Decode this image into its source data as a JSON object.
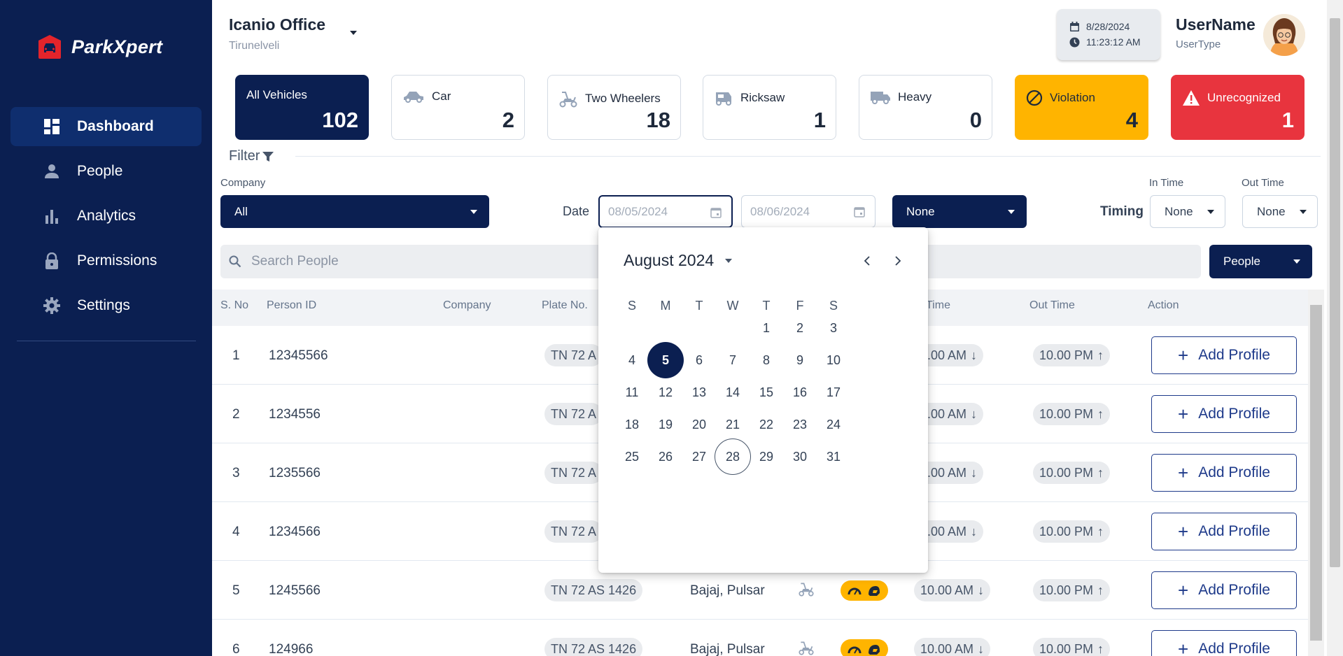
{
  "brand": {
    "name": "ParkXpert"
  },
  "nav": [
    {
      "label": "Dashboard",
      "icon": "dashboard-icon",
      "active": true
    },
    {
      "label": "People",
      "icon": "person-icon"
    },
    {
      "label": "Analytics",
      "icon": "bar-chart-icon"
    },
    {
      "label": "Permissions",
      "icon": "lock-icon"
    },
    {
      "label": "Settings",
      "icon": "gear-icon"
    }
  ],
  "header": {
    "office_name": "Icanio Office",
    "office_location": "Tirunelveli",
    "date": "8/28/2024",
    "time": "11:23:12 AM",
    "user_name": "UserName",
    "user_type": "UserType"
  },
  "stats": [
    {
      "label": "All Vehicles",
      "value": "102",
      "style": "dark"
    },
    {
      "label": "Car",
      "value": "2",
      "icon": "car-icon"
    },
    {
      "label": "Two Wheelers",
      "value": "18",
      "icon": "scooter-icon"
    },
    {
      "label": "Ricksaw",
      "value": "1",
      "icon": "rickshaw-icon"
    },
    {
      "label": "Heavy",
      "value": "0",
      "icon": "truck-icon"
    },
    {
      "label": "Violation",
      "value": "4",
      "icon": "ban-icon",
      "style": "yellow"
    },
    {
      "label": "Unrecognized",
      "value": "1",
      "icon": "warning-icon",
      "style": "red"
    }
  ],
  "filter": {
    "title": "Filter",
    "company_label": "Company",
    "company_value": "All",
    "date_label": "Date",
    "date_from": "08/05/2024",
    "date_to": "08/06/2024",
    "type_value": "None",
    "timing_label": "Timing",
    "in_time_label": "In Time",
    "in_time_value": "None",
    "out_time_label": "Out Time",
    "out_time_value": "None"
  },
  "search": {
    "placeholder": "Search People",
    "scope": "People"
  },
  "table": {
    "headers": [
      "S. No",
      "Person ID",
      "Company",
      "Plate No.",
      "Time",
      "Out Time",
      "Action"
    ],
    "rows": [
      {
        "sno": "1",
        "person_id": "12345566",
        "plate": "TN 72 A",
        "in_time": "0.00 AM",
        "out_time": "10.00 PM",
        "action": "Add Profile"
      },
      {
        "sno": "2",
        "person_id": "1234556",
        "plate": "TN 72 A",
        "in_time": "0.00 AM",
        "out_time": "10.00 PM",
        "action": "Add Profile"
      },
      {
        "sno": "3",
        "person_id": "1235566",
        "plate": "TN 72 A",
        "in_time": "0.00 AM",
        "out_time": "10.00 PM",
        "action": "Add Profile"
      },
      {
        "sno": "4",
        "person_id": "1234566",
        "plate": "TN 72 A",
        "in_time": "0.00 AM",
        "out_time": "10.00 PM",
        "action": "Add Profile"
      },
      {
        "sno": "5",
        "person_id": "1245566",
        "plate": "TN 72 AS 1426",
        "vehicle": "Bajaj, Pulsar",
        "in_time": "10.00 AM",
        "out_time": "10.00 PM",
        "action": "Add Profile"
      },
      {
        "sno": "6",
        "person_id": "124966",
        "plate": "TN 72 AS 1426",
        "vehicle": "Bajaj, Pulsar",
        "in_time": "10.00 AM",
        "out_time": "10.00 PM",
        "action": "Add Profile"
      }
    ]
  },
  "calendar": {
    "month_year": "August 2024",
    "weekdays": [
      "S",
      "M",
      "T",
      "W",
      "T",
      "F",
      "S"
    ],
    "first_weekday_index": 4,
    "days_in_month": 31,
    "selected_day": 5,
    "today": 28
  }
}
